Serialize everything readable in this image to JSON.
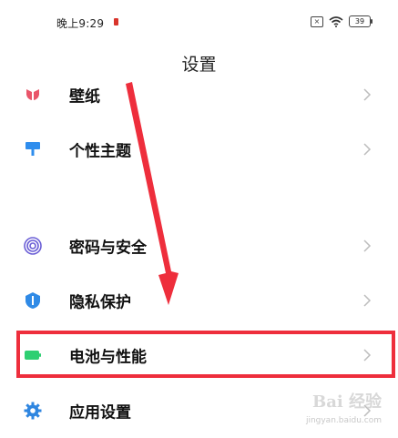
{
  "status_bar": {
    "time": "晚上9:29",
    "battery": "39"
  },
  "title": "设置",
  "items": [
    {
      "label": "壁纸",
      "icon": "wallpaper-icon",
      "color": "#e9556a"
    },
    {
      "label": "个性主题",
      "icon": "brush-icon",
      "color": "#2e8ded"
    },
    {
      "label": "密码与安全",
      "icon": "fingerprint-icon",
      "color": "#6b5fd6"
    },
    {
      "label": "隐私保护",
      "icon": "shield-icon",
      "color": "#2f8ae6"
    },
    {
      "label": "电池与性能",
      "icon": "battery-icon",
      "color": "#2ecf72"
    },
    {
      "label": "应用设置",
      "icon": "gear-icon",
      "color": "#2f86e0"
    }
  ],
  "watermark": {
    "main": "Bai 经验",
    "sub": "jingyan.baidu.com"
  },
  "annotation_color": "#ee2e3c"
}
